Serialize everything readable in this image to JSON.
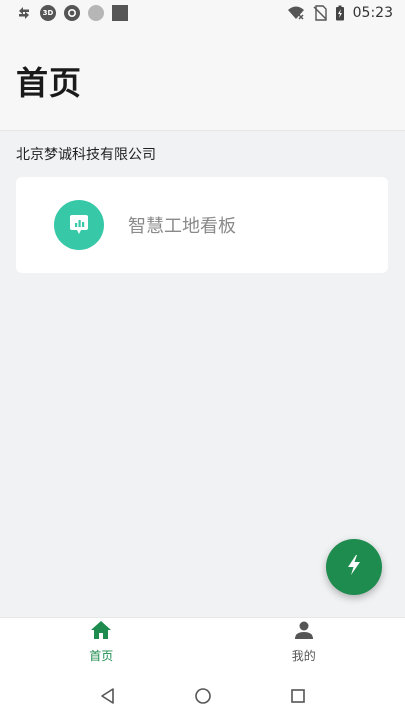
{
  "status_bar": {
    "time": "05:23",
    "left_icons": [
      "sync-icon",
      "3d-badge-icon",
      "q-badge-icon",
      "circle-icon",
      "square-icon"
    ],
    "right_icons": [
      "wifi-off-icon",
      "no-sim-icon",
      "battery-charging-icon"
    ]
  },
  "header": {
    "title": "首页"
  },
  "company": {
    "name": "北京梦诚科技有限公司"
  },
  "card": {
    "label": "智慧工地看板",
    "icon": "dashboard-chart-icon",
    "icon_color": "#37c8a8"
  },
  "fab": {
    "icon": "lightning-icon",
    "color": "#1e8c4e"
  },
  "tabbar": {
    "active_color": "#1e8c4e",
    "tabs": [
      {
        "label": "首页",
        "icon": "home-icon",
        "active": true
      },
      {
        "label": "我的",
        "icon": "person-icon",
        "active": false
      }
    ]
  },
  "navbar": {
    "buttons": [
      "back-icon",
      "home-circle-icon",
      "recents-icon"
    ]
  }
}
